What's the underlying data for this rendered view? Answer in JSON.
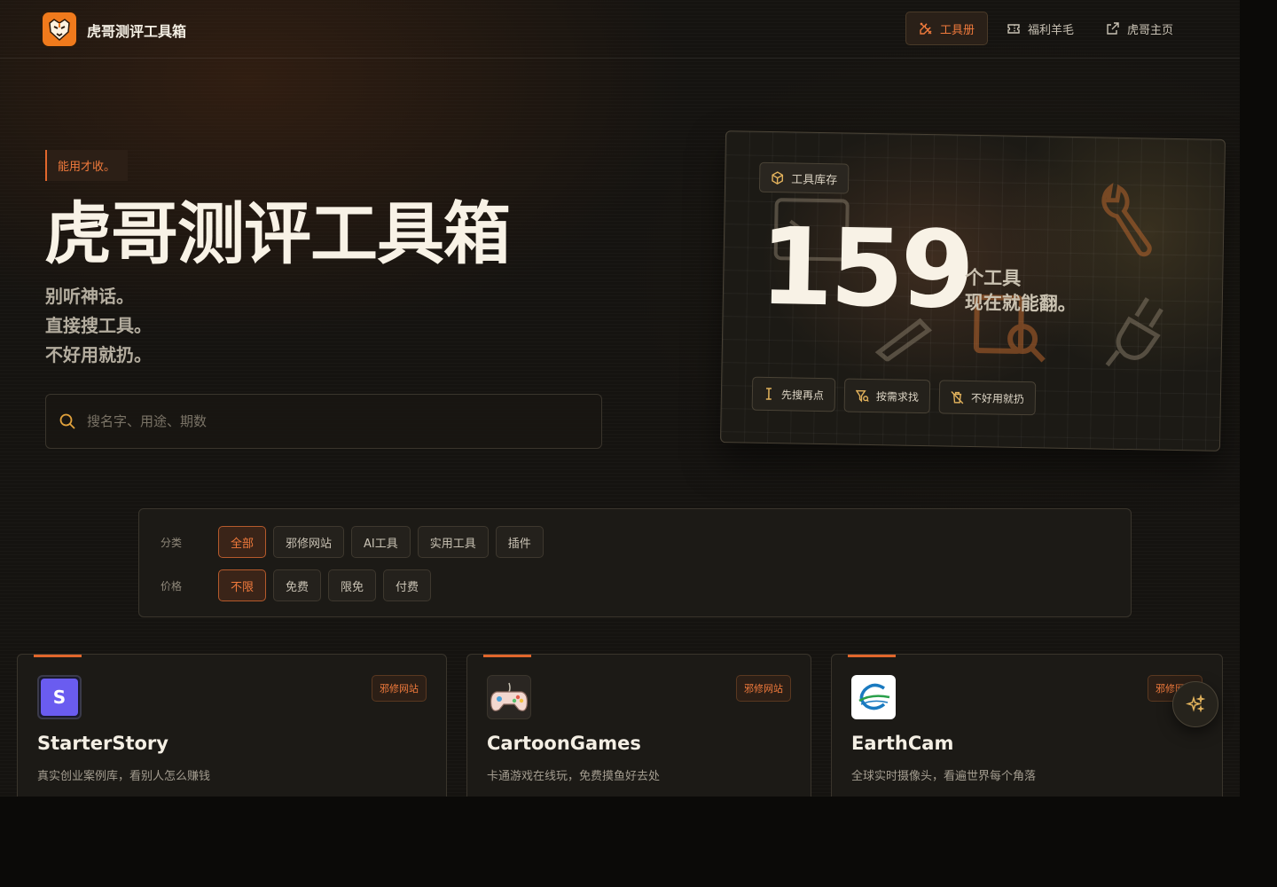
{
  "header": {
    "brand": "虎哥测评工具箱",
    "nav": [
      {
        "label": "工具册",
        "icon": "tools-icon",
        "active": true
      },
      {
        "label": "福利羊毛",
        "icon": "ticket-icon",
        "active": false
      },
      {
        "label": "虎哥主页",
        "icon": "external-link-icon",
        "active": false
      }
    ]
  },
  "hero": {
    "tagline": "能用才收。",
    "title": "虎哥测评工具箱",
    "lines": [
      "别听神话。",
      "直接搜工具。",
      "不好用就扔。"
    ],
    "search_placeholder": "搜名字、用途、期数"
  },
  "stats": {
    "badge": "工具库存",
    "count": "159",
    "desc_line1": "个工具",
    "desc_line2": "现在就能翻。",
    "chips": [
      {
        "label": "先搜再点",
        "icon": "cursor-icon"
      },
      {
        "label": "按需求找",
        "icon": "filter-icon"
      },
      {
        "label": "不好用就扔",
        "icon": "trash-off-icon"
      }
    ]
  },
  "filter": {
    "category_label": "分类",
    "categories": [
      "全部",
      "邪修网站",
      "AI工具",
      "实用工具",
      "插件"
    ],
    "category_selected": "全部",
    "price_label": "价格",
    "prices": [
      "不限",
      "免费",
      "限免",
      "付费"
    ],
    "price_selected": "不限"
  },
  "cards": [
    {
      "title": "StarterStory",
      "desc": "真实创业案例库，看别人怎么赚钱",
      "tag": "邪修网站",
      "icon_letter": "S"
    },
    {
      "title": "CartoonGames",
      "desc": "卡通游戏在线玩，免费摸鱼好去处",
      "tag": "邪修网站"
    },
    {
      "title": "EarthCam",
      "desc": "全球实时摄像头，看遍世界每个角落",
      "tag": "邪修网站"
    }
  ],
  "colors": {
    "accent": "#e2672c",
    "background": "#151310"
  }
}
